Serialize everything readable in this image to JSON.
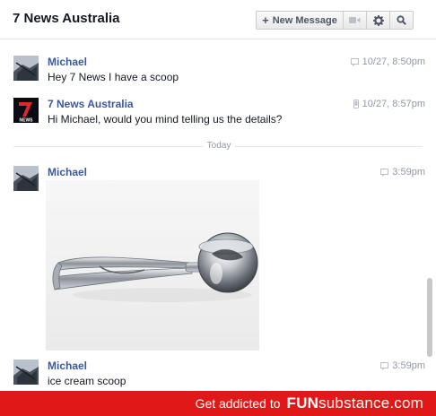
{
  "header": {
    "title": "7 News Australia",
    "new_message_label": "New Message",
    "video_icon": "video-camera-icon",
    "settings_icon": "gear-icon",
    "search_icon": "search-icon"
  },
  "messages": [
    {
      "sender": "Michael",
      "text": "Hey 7 News I have a scoop",
      "time": "10/27, 8:50pm",
      "device_icon": "web-chat-icon"
    },
    {
      "sender": "7 News Australia",
      "text": "Hi Michael, would you mind telling us the details?",
      "time": "10/27, 8:57pm",
      "device_icon": "mobile-phone-icon"
    },
    {
      "sender": "Michael",
      "text": "",
      "time": "3:59pm",
      "device_icon": "web-chat-icon",
      "attachment": "ice cream scoop photo"
    },
    {
      "sender": "Michael",
      "text": "ice cream scoop",
      "time": "3:59pm",
      "device_icon": "web-chat-icon"
    }
  ],
  "divider_label": "Today",
  "banner": {
    "text": "Get addicted to",
    "brand_bold": "FUN",
    "brand_rest": "substance.com"
  },
  "colors": {
    "accent": "#3b5998",
    "banner": "#e01818",
    "timestamp": "#9197a3"
  }
}
